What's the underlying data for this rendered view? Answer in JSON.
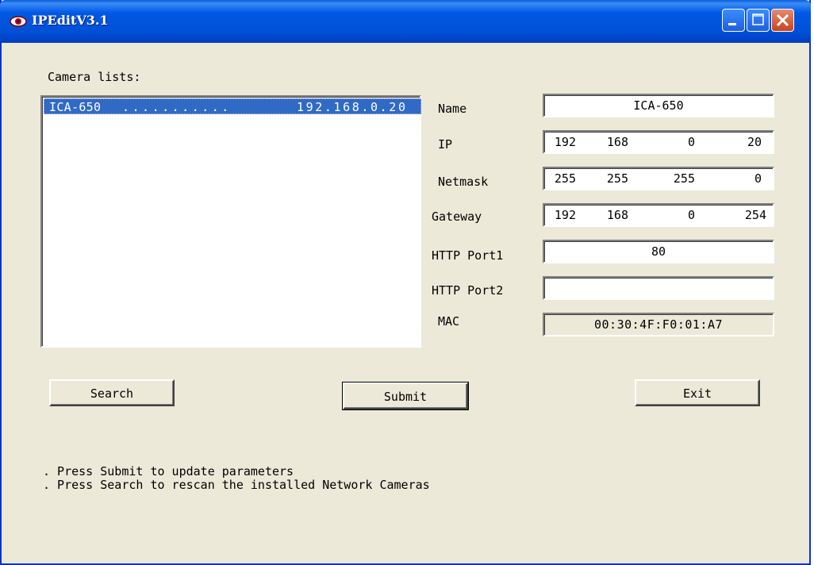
{
  "window": {
    "title": "IPEditV3.1"
  },
  "camera_list": {
    "label": "Camera lists:",
    "items": [
      {
        "name": "ICA-650",
        "separator": "...........",
        "ip": "192.168.0.20",
        "selected": true
      }
    ]
  },
  "fields": {
    "name": {
      "label": "Name",
      "value": "ICA-650"
    },
    "ip": {
      "label": "IP",
      "octets": [
        "192",
        "168",
        "0",
        "20"
      ]
    },
    "netmask": {
      "label": "Netmask",
      "octets": [
        "255",
        "255",
        "255",
        "0"
      ]
    },
    "gateway": {
      "label": "Gateway",
      "octets": [
        "192",
        "168",
        "0",
        "254"
      ]
    },
    "http_port1": {
      "label": "HTTP Port1",
      "value": "80"
    },
    "http_port2": {
      "label": "HTTP Port2",
      "value": ""
    },
    "mac": {
      "label": "MAC",
      "value": "00:30:4F:F0:01:A7"
    }
  },
  "buttons": {
    "search": "Search",
    "submit": "Submit",
    "exit": "Exit"
  },
  "help": [
    ". Press Submit to update parameters",
    ". Press Search to rescan the installed Network Cameras"
  ],
  "colors": {
    "titlebar": "#0054e3",
    "selection": "#316ac5",
    "window_bg": "#ece9d8"
  },
  "icons": {
    "app": "eye-icon",
    "minimize": "minimize-icon",
    "maximize": "maximize-icon",
    "close": "close-icon"
  }
}
